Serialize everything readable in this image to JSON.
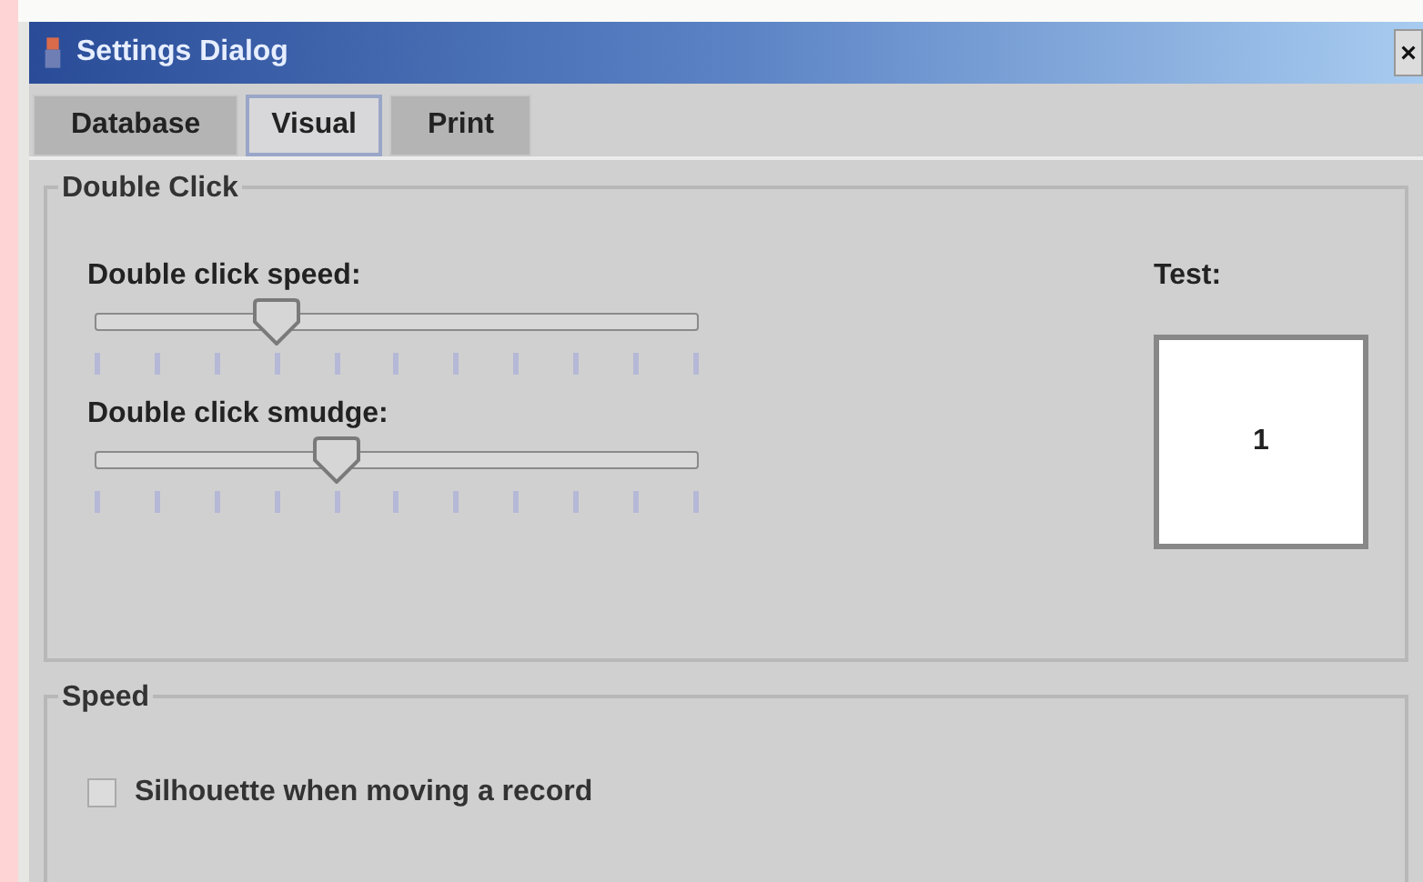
{
  "window": {
    "title": "Settings Dialog"
  },
  "tabs": [
    {
      "label": "Database",
      "selected": false
    },
    {
      "label": "Visual",
      "selected": true
    },
    {
      "label": "Print",
      "selected": false
    }
  ],
  "double_click": {
    "title": "Double Click",
    "sliders": [
      {
        "label": "Double click speed:",
        "level": 0.3
      },
      {
        "label": "Double click smudge:",
        "level": 0.4
      }
    ],
    "test": {
      "label": "Test:",
      "value": "1"
    }
  },
  "speed": {
    "title": "Speed",
    "checkbox": {
      "label": "Silhouette when moving a record",
      "checked": false
    }
  }
}
